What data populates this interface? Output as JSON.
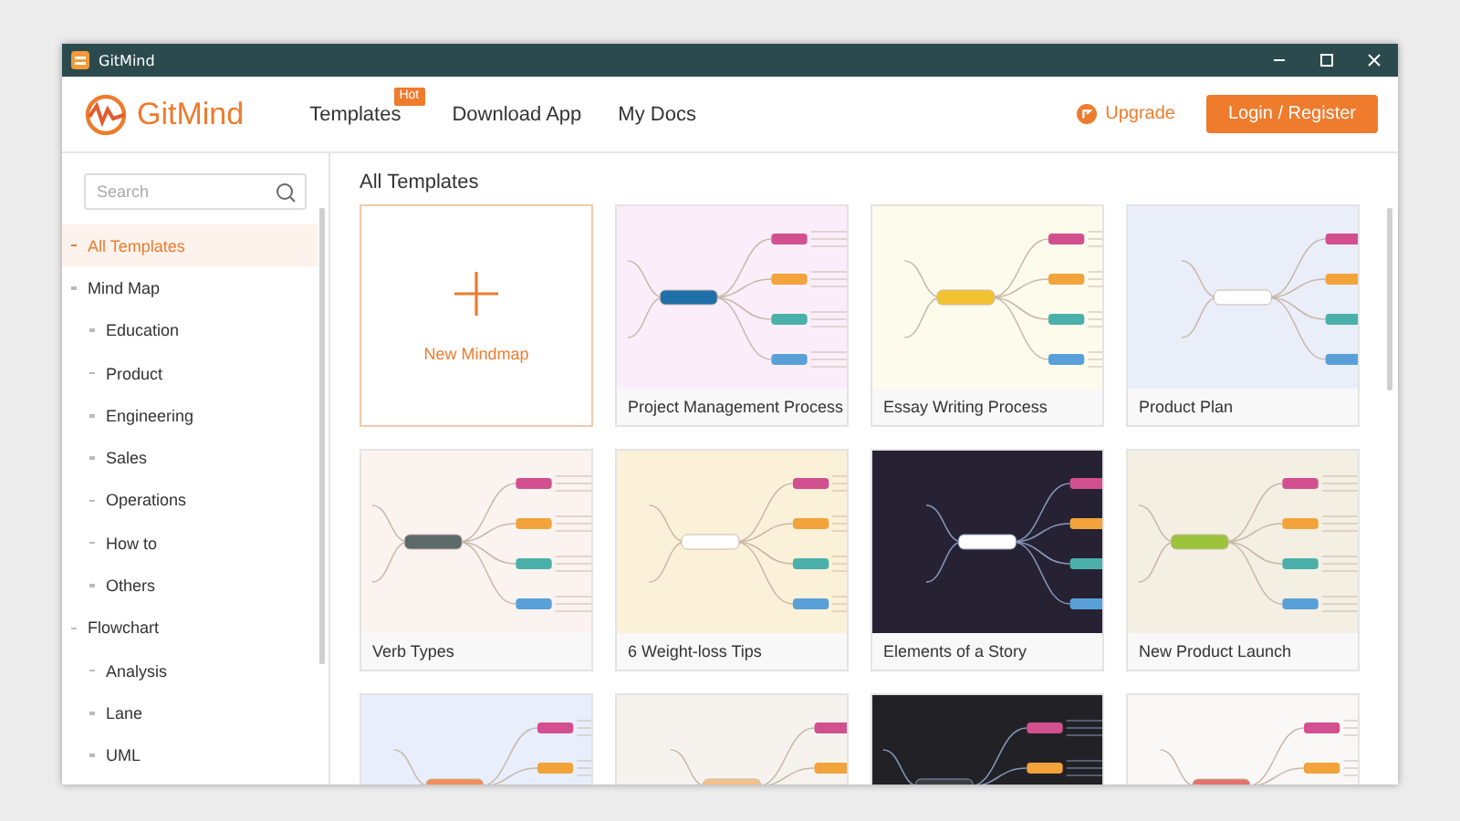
{
  "window": {
    "title": "GitMind"
  },
  "header": {
    "logo": "GitMind",
    "nav": [
      {
        "label": "Templates",
        "badge": "Hot"
      },
      {
        "label": "Download App"
      },
      {
        "label": "My Docs"
      }
    ],
    "upgrade": "Upgrade",
    "login": "Login / Register"
  },
  "sidebar": {
    "search": {
      "placeholder": "Search"
    },
    "items": [
      {
        "label": "All Templates",
        "selected": true
      },
      {
        "label": "Mind Map",
        "selected": false,
        "children": [
          {
            "label": "Education",
            "selected": false
          },
          {
            "label": "Product",
            "selected": false
          },
          {
            "label": "Engineering",
            "selected": false
          },
          {
            "label": "Sales",
            "selected": false
          },
          {
            "label": "Operations",
            "selected": false
          },
          {
            "label": "How to",
            "selected": false
          },
          {
            "label": "Others",
            "selected": false
          }
        ]
      },
      {
        "label": "Flowchart",
        "selected": false,
        "children": [
          {
            "label": "Analysis",
            "selected": false
          },
          {
            "label": "Lane",
            "selected": false
          },
          {
            "label": "UML",
            "selected": false
          }
        ]
      }
    ]
  },
  "content": {
    "heading": "All Templates",
    "cards": [
      {
        "kind": "new",
        "label": "New Mindmap"
      },
      {
        "kind": "template",
        "title": "Project Management Process"
      },
      {
        "kind": "template",
        "title": "Essay Writing Process"
      },
      {
        "kind": "template",
        "title": "Product Plan"
      },
      {
        "kind": "template",
        "title": "Verb Types"
      },
      {
        "kind": "template",
        "title": "6 Weight-loss Tips"
      },
      {
        "kind": "template",
        "title": "Elements of a Story"
      },
      {
        "kind": "template",
        "title": "New Product Launch"
      },
      {
        "kind": "template"
      },
      {
        "kind": "template"
      },
      {
        "kind": "template"
      },
      {
        "kind": "template"
      }
    ]
  }
}
